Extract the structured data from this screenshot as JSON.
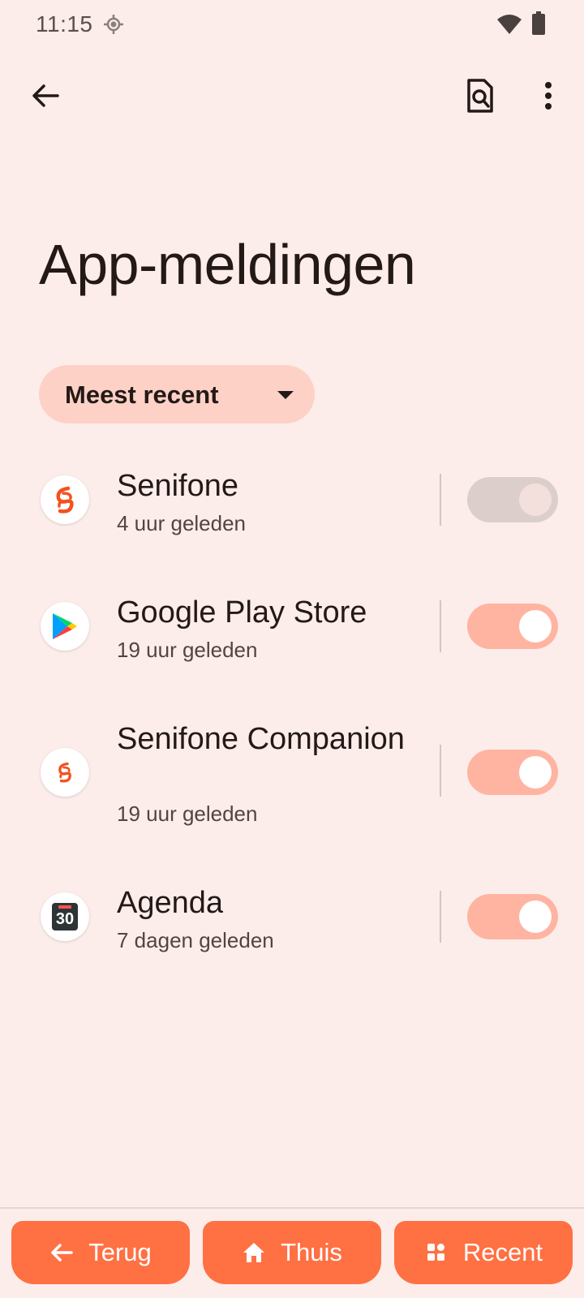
{
  "status_bar": {
    "time": "11:15"
  },
  "header": {
    "title": "App-meldingen"
  },
  "sort": {
    "selected": "Meest recent"
  },
  "apps": [
    {
      "name": "Senifone",
      "time": "4 uur geleden",
      "enabled": true,
      "disabled_state": true
    },
    {
      "name": "Google Play Store",
      "time": "19 uur geleden",
      "enabled": true
    },
    {
      "name": "Senifone Companion",
      "time": "19 uur geleden",
      "enabled": true
    },
    {
      "name": "Agenda",
      "time": "7 dagen geleden",
      "enabled": true,
      "calendar_day": "30"
    }
  ],
  "bottom_nav": {
    "back": "Terug",
    "home": "Thuis",
    "recent": "Recent"
  },
  "colors": {
    "accent": "#ff7043",
    "toggle_on": "#ffb4a1",
    "background": "#fcedea",
    "chip": "#fdd1c5"
  }
}
